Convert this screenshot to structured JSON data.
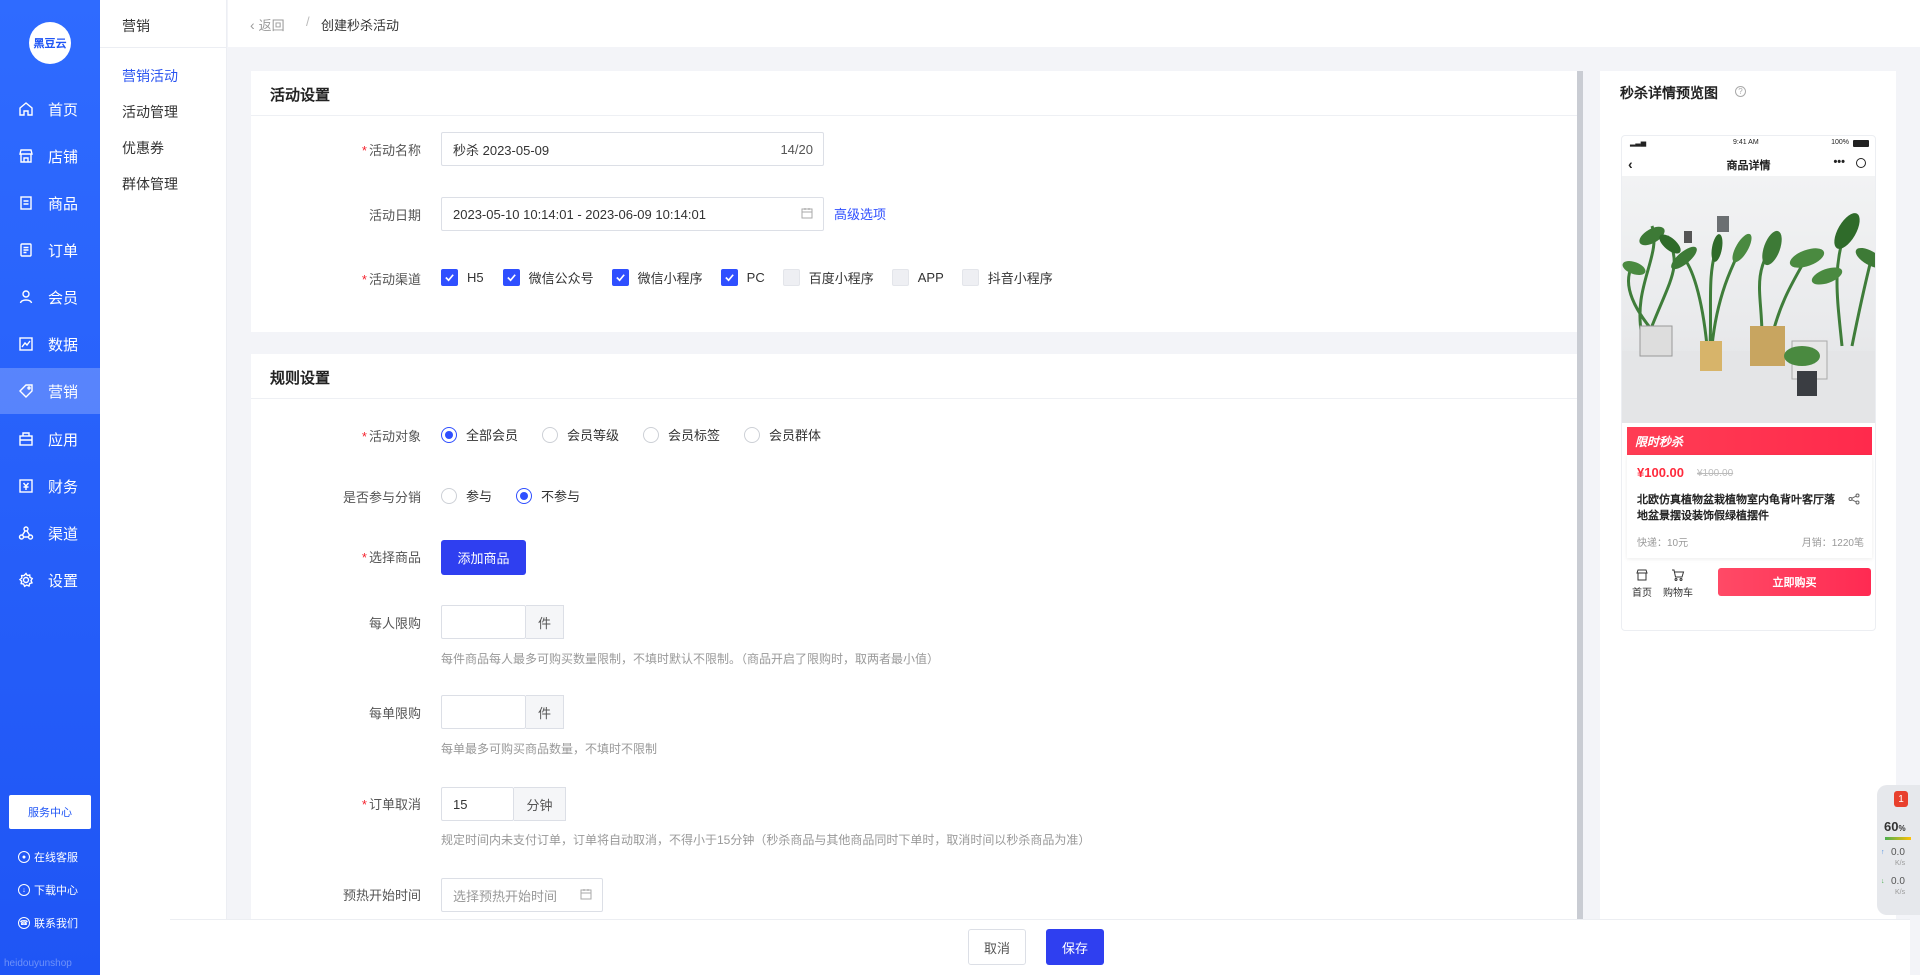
{
  "sidebar": {
    "logo": "黑豆云",
    "items": [
      {
        "label": "首页",
        "icon": "home-icon"
      },
      {
        "label": "店铺",
        "icon": "shop-icon"
      },
      {
        "label": "商品",
        "icon": "product-icon"
      },
      {
        "label": "订单",
        "icon": "order-icon"
      },
      {
        "label": "会员",
        "icon": "member-icon"
      },
      {
        "label": "数据",
        "icon": "data-icon"
      },
      {
        "label": "营销",
        "icon": "tag-icon"
      },
      {
        "label": "应用",
        "icon": "app-icon"
      },
      {
        "label": "财务",
        "icon": "finance-icon"
      },
      {
        "label": "渠道",
        "icon": "channel-icon"
      },
      {
        "label": "设置",
        "icon": "gear-icon"
      }
    ],
    "active": "营销",
    "service_center": "服务中心",
    "links": [
      {
        "label": "在线客服",
        "icon": "chat-icon"
      },
      {
        "label": "下载中心",
        "icon": "download-icon"
      },
      {
        "label": "联系我们",
        "icon": "contact-icon"
      }
    ],
    "watermark": "heidouyunshop"
  },
  "submenu": {
    "title": "营销",
    "items": [
      "营销活动",
      "活动管理",
      "优惠券",
      "群体管理"
    ],
    "active": "营销活动"
  },
  "topbar": {
    "back": "返回",
    "separator": "/",
    "title": "创建秒杀活动"
  },
  "activity_settings": {
    "title": "活动设置",
    "name_label": "活动名称",
    "name_value": "秒杀  2023-05-09",
    "name_count": "14/20",
    "date_label": "活动日期",
    "date_value": "2023-05-10 10:14:01 - 2023-06-09 10:14:01",
    "advanced_link": "高级选项",
    "channel_label": "活动渠道",
    "channels": [
      {
        "label": "H5",
        "checked": true
      },
      {
        "label": "微信公众号",
        "checked": true
      },
      {
        "label": "微信小程序",
        "checked": true
      },
      {
        "label": "PC",
        "checked": true
      },
      {
        "label": "百度小程序",
        "checked": false
      },
      {
        "label": "APP",
        "checked": false
      },
      {
        "label": "抖音小程序",
        "checked": false
      }
    ]
  },
  "rule_settings": {
    "title": "规则设置",
    "target_label": "活动对象",
    "targets": [
      {
        "label": "全部会员",
        "selected": true
      },
      {
        "label": "会员等级",
        "selected": false
      },
      {
        "label": "会员标签",
        "selected": false
      },
      {
        "label": "会员群体",
        "selected": false
      }
    ],
    "distribution_label": "是否参与分销",
    "distribution_options": [
      {
        "label": "参与",
        "selected": false
      },
      {
        "label": "不参与",
        "selected": true
      }
    ],
    "product_label": "选择商品",
    "add_product_button": "添加商品",
    "per_person_label": "每人限购",
    "per_person_value": "",
    "per_person_unit": "件",
    "per_person_hint": "每件商品每人最多可购买数量限制，不填时默认不限制。（商品开启了限购时，取两者最小值）",
    "per_order_label": "每单限购",
    "per_order_value": "",
    "per_order_unit": "件",
    "per_order_hint": "每单最多可购买商品数量，不填时不限制",
    "cancel_label": "订单取消",
    "cancel_value": "15",
    "cancel_unit": "分钟",
    "cancel_hint": "规定时间内未支付订单，订单将自动取消，不得小于15分钟（秒杀商品与其他商品同时下单时，取消时间以秒杀商品为准）",
    "preheat_label": "预热开始时间",
    "preheat_placeholder": "选择预热开始时间"
  },
  "preview": {
    "title": "秒杀详情预览图",
    "status_time": "9:41 AM",
    "status_battery": "100%",
    "nav_title": "商品详情",
    "flash_label": "限时秒杀",
    "price": "¥100.00",
    "old_price": "¥100.00",
    "product_name": "北欧仿真植物盆栽植物室内龟背叶客厅落地盆景摆设装饰假绿植摆件",
    "shipping": "快递：10元",
    "sales": "月销：1220笔",
    "bottom_home": "首页",
    "bottom_cart": "购物车",
    "buy_button": "立即购买"
  },
  "footer": {
    "cancel": "取消",
    "save": "保存"
  },
  "monitor": {
    "badge": "1",
    "cpu": "60",
    "cpu_unit": "%",
    "up": "0.0",
    "up_unit": "K/s",
    "down": "0.0",
    "down_unit": "K/s"
  },
  "colors": {
    "primary": "#2f3ff0",
    "sidebar": "#1f55f5",
    "danger": "#ff2a3c"
  }
}
